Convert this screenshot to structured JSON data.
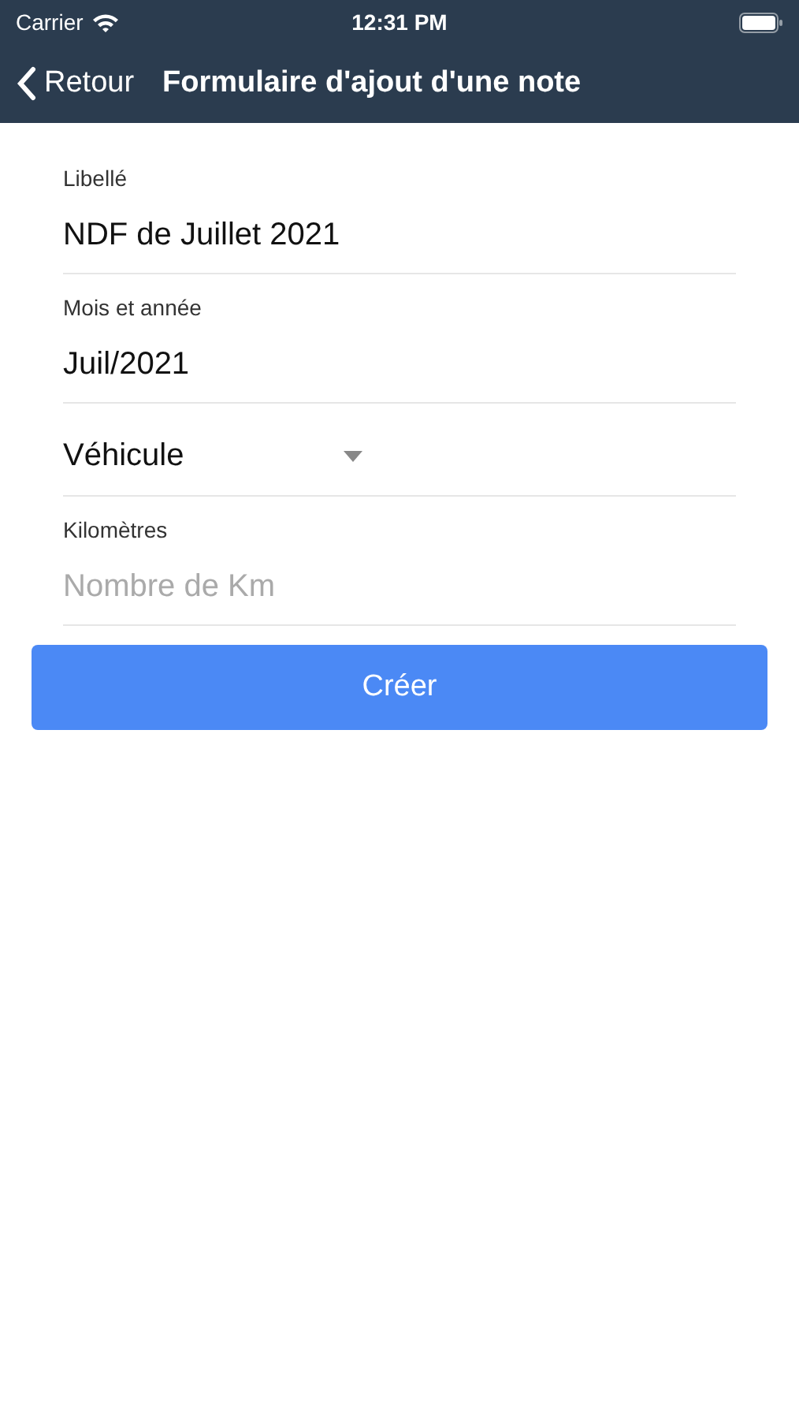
{
  "status_bar": {
    "carrier": "Carrier",
    "time": "12:31 PM"
  },
  "nav": {
    "back": "Retour",
    "title": "Formulaire d'ajout d'une note"
  },
  "fields": [
    {
      "kind": "text",
      "label": "Libellé",
      "value": "NDF de Juillet 2021"
    },
    {
      "kind": "text",
      "label": "Mois et année",
      "value": "Juil/2021"
    },
    {
      "kind": "select",
      "value": "Véhicule"
    },
    {
      "kind": "text",
      "label": "Kilomètres",
      "placeholder": "Nombre de Km"
    }
  ],
  "button": "Créer"
}
